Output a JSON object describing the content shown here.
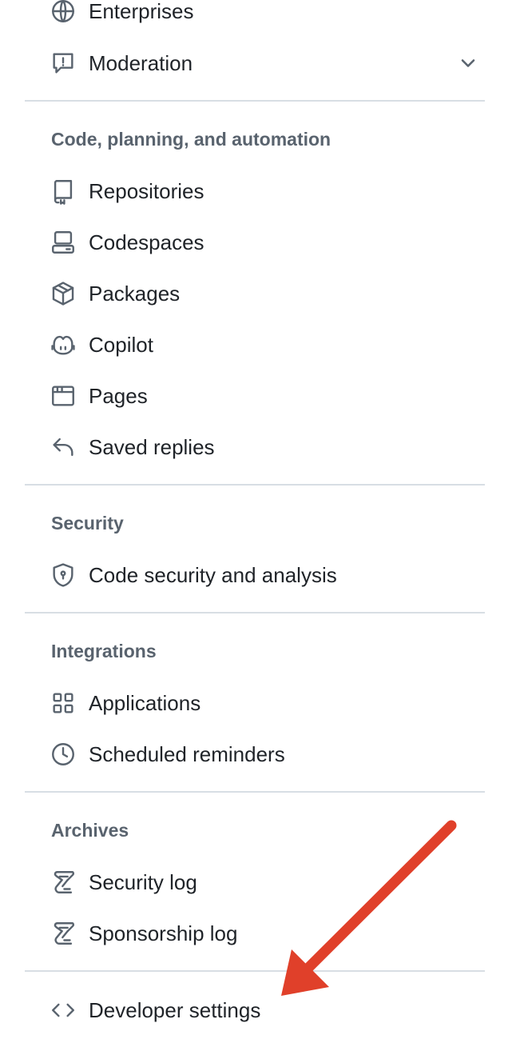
{
  "nav": {
    "enterprises": "Enterprises",
    "moderation": "Moderation",
    "sections": {
      "code": "Code, planning, and automation",
      "security": "Security",
      "integrations": "Integrations",
      "archives": "Archives"
    },
    "code_items": [
      "Repositories",
      "Codespaces",
      "Packages",
      "Copilot",
      "Pages",
      "Saved replies"
    ],
    "security_items": [
      "Code security and analysis"
    ],
    "integrations_items": [
      "Applications",
      "Scheduled reminders"
    ],
    "archives_items": [
      "Security log",
      "Sponsorship log"
    ],
    "developer_settings": "Developer settings"
  },
  "annotation": {
    "arrow_color": "#e0402a"
  }
}
